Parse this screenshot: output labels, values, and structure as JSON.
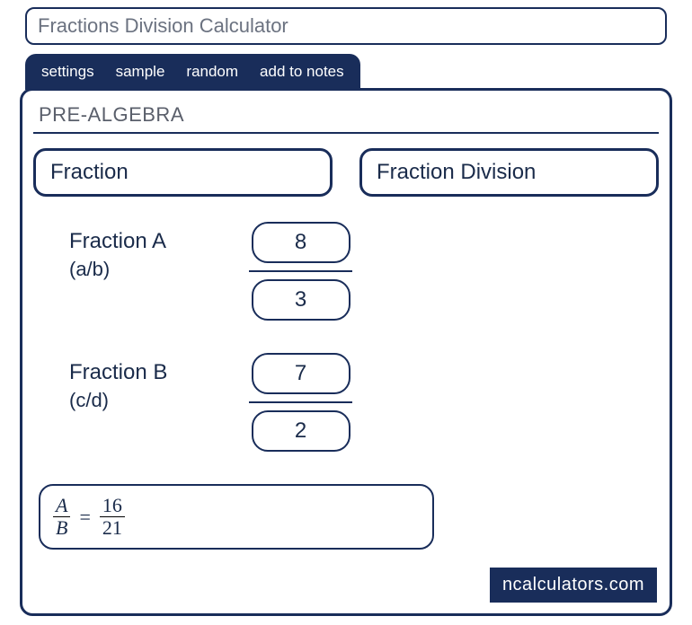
{
  "title": "Fractions Division Calculator",
  "tabs": {
    "settings": "settings",
    "sample": "sample",
    "random": "random",
    "addnotes": "add to notes"
  },
  "breadcrumb": "PRE-ALGEBRA",
  "selectors": {
    "topic": "Fraction",
    "operation": "Fraction Division"
  },
  "inputA": {
    "label": "Fraction A",
    "sub": "(a/b)",
    "num": "8",
    "den": "3"
  },
  "inputB": {
    "label": "Fraction B",
    "sub": "(c/d)",
    "num": "7",
    "den": "2"
  },
  "result": {
    "left_num": "A",
    "left_den": "B",
    "eq": "=",
    "right_num": "16",
    "right_den": "21"
  },
  "brand": "ncalculators.com"
}
